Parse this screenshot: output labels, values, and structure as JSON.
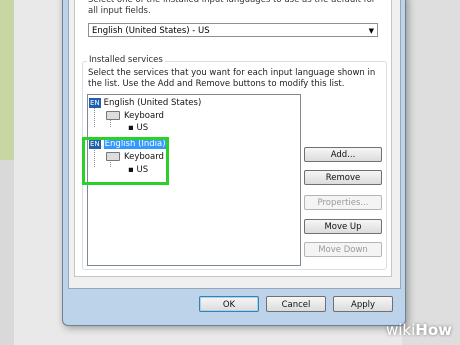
{
  "top_description": "Select one of the installed input languages to use as the default for all input fields.",
  "default_language": "English (United States) - US",
  "installed_services": {
    "label": "Installed services",
    "description": "Select the services that you want for each input language shown in the list. Use the Add and Remove buttons to modify this list.",
    "tree": [
      {
        "badge": "EN",
        "language": "English (United States)",
        "category": "Keyboard",
        "layout": "US"
      },
      {
        "badge": "EN",
        "language": "English (India)",
        "category": "Keyboard",
        "layout": "US"
      }
    ]
  },
  "side_buttons": {
    "add": "Add...",
    "remove": "Remove",
    "properties": "Properties...",
    "move_up": "Move Up",
    "move_down": "Move Down"
  },
  "footer_buttons": {
    "ok": "OK",
    "cancel": "Cancel",
    "apply": "Apply"
  },
  "watermark": {
    "part1": "wiki",
    "part2": "How"
  }
}
